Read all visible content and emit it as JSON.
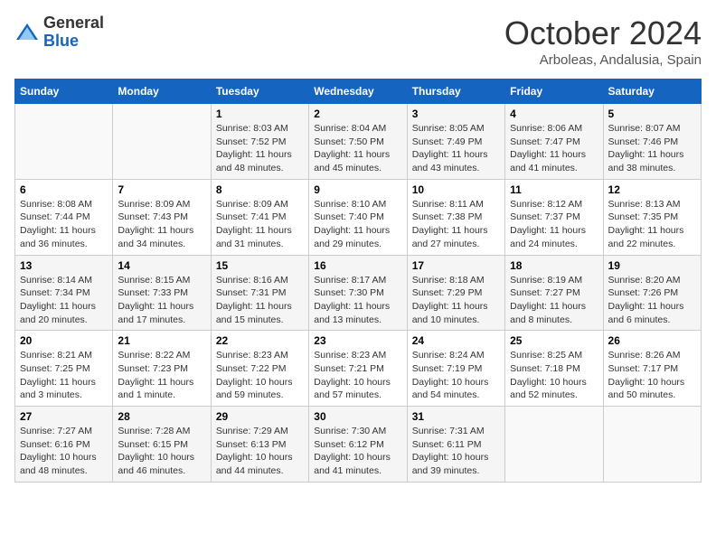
{
  "logo": {
    "general": "General",
    "blue": "Blue"
  },
  "header": {
    "month": "October 2024",
    "location": "Arboleas, Andalusia, Spain"
  },
  "days_of_week": [
    "Sunday",
    "Monday",
    "Tuesday",
    "Wednesday",
    "Thursday",
    "Friday",
    "Saturday"
  ],
  "weeks": [
    [
      {
        "day": "",
        "info": ""
      },
      {
        "day": "",
        "info": ""
      },
      {
        "day": "1",
        "info": "Sunrise: 8:03 AM\nSunset: 7:52 PM\nDaylight: 11 hours and 48 minutes."
      },
      {
        "day": "2",
        "info": "Sunrise: 8:04 AM\nSunset: 7:50 PM\nDaylight: 11 hours and 45 minutes."
      },
      {
        "day": "3",
        "info": "Sunrise: 8:05 AM\nSunset: 7:49 PM\nDaylight: 11 hours and 43 minutes."
      },
      {
        "day": "4",
        "info": "Sunrise: 8:06 AM\nSunset: 7:47 PM\nDaylight: 11 hours and 41 minutes."
      },
      {
        "day": "5",
        "info": "Sunrise: 8:07 AM\nSunset: 7:46 PM\nDaylight: 11 hours and 38 minutes."
      }
    ],
    [
      {
        "day": "6",
        "info": "Sunrise: 8:08 AM\nSunset: 7:44 PM\nDaylight: 11 hours and 36 minutes."
      },
      {
        "day": "7",
        "info": "Sunrise: 8:09 AM\nSunset: 7:43 PM\nDaylight: 11 hours and 34 minutes."
      },
      {
        "day": "8",
        "info": "Sunrise: 8:09 AM\nSunset: 7:41 PM\nDaylight: 11 hours and 31 minutes."
      },
      {
        "day": "9",
        "info": "Sunrise: 8:10 AM\nSunset: 7:40 PM\nDaylight: 11 hours and 29 minutes."
      },
      {
        "day": "10",
        "info": "Sunrise: 8:11 AM\nSunset: 7:38 PM\nDaylight: 11 hours and 27 minutes."
      },
      {
        "day": "11",
        "info": "Sunrise: 8:12 AM\nSunset: 7:37 PM\nDaylight: 11 hours and 24 minutes."
      },
      {
        "day": "12",
        "info": "Sunrise: 8:13 AM\nSunset: 7:35 PM\nDaylight: 11 hours and 22 minutes."
      }
    ],
    [
      {
        "day": "13",
        "info": "Sunrise: 8:14 AM\nSunset: 7:34 PM\nDaylight: 11 hours and 20 minutes."
      },
      {
        "day": "14",
        "info": "Sunrise: 8:15 AM\nSunset: 7:33 PM\nDaylight: 11 hours and 17 minutes."
      },
      {
        "day": "15",
        "info": "Sunrise: 8:16 AM\nSunset: 7:31 PM\nDaylight: 11 hours and 15 minutes."
      },
      {
        "day": "16",
        "info": "Sunrise: 8:17 AM\nSunset: 7:30 PM\nDaylight: 11 hours and 13 minutes."
      },
      {
        "day": "17",
        "info": "Sunrise: 8:18 AM\nSunset: 7:29 PM\nDaylight: 11 hours and 10 minutes."
      },
      {
        "day": "18",
        "info": "Sunrise: 8:19 AM\nSunset: 7:27 PM\nDaylight: 11 hours and 8 minutes."
      },
      {
        "day": "19",
        "info": "Sunrise: 8:20 AM\nSunset: 7:26 PM\nDaylight: 11 hours and 6 minutes."
      }
    ],
    [
      {
        "day": "20",
        "info": "Sunrise: 8:21 AM\nSunset: 7:25 PM\nDaylight: 11 hours and 3 minutes."
      },
      {
        "day": "21",
        "info": "Sunrise: 8:22 AM\nSunset: 7:23 PM\nDaylight: 11 hours and 1 minute."
      },
      {
        "day": "22",
        "info": "Sunrise: 8:23 AM\nSunset: 7:22 PM\nDaylight: 10 hours and 59 minutes."
      },
      {
        "day": "23",
        "info": "Sunrise: 8:23 AM\nSunset: 7:21 PM\nDaylight: 10 hours and 57 minutes."
      },
      {
        "day": "24",
        "info": "Sunrise: 8:24 AM\nSunset: 7:19 PM\nDaylight: 10 hours and 54 minutes."
      },
      {
        "day": "25",
        "info": "Sunrise: 8:25 AM\nSunset: 7:18 PM\nDaylight: 10 hours and 52 minutes."
      },
      {
        "day": "26",
        "info": "Sunrise: 8:26 AM\nSunset: 7:17 PM\nDaylight: 10 hours and 50 minutes."
      }
    ],
    [
      {
        "day": "27",
        "info": "Sunrise: 7:27 AM\nSunset: 6:16 PM\nDaylight: 10 hours and 48 minutes."
      },
      {
        "day": "28",
        "info": "Sunrise: 7:28 AM\nSunset: 6:15 PM\nDaylight: 10 hours and 46 minutes."
      },
      {
        "day": "29",
        "info": "Sunrise: 7:29 AM\nSunset: 6:13 PM\nDaylight: 10 hours and 44 minutes."
      },
      {
        "day": "30",
        "info": "Sunrise: 7:30 AM\nSunset: 6:12 PM\nDaylight: 10 hours and 41 minutes."
      },
      {
        "day": "31",
        "info": "Sunrise: 7:31 AM\nSunset: 6:11 PM\nDaylight: 10 hours and 39 minutes."
      },
      {
        "day": "",
        "info": ""
      },
      {
        "day": "",
        "info": ""
      }
    ]
  ]
}
